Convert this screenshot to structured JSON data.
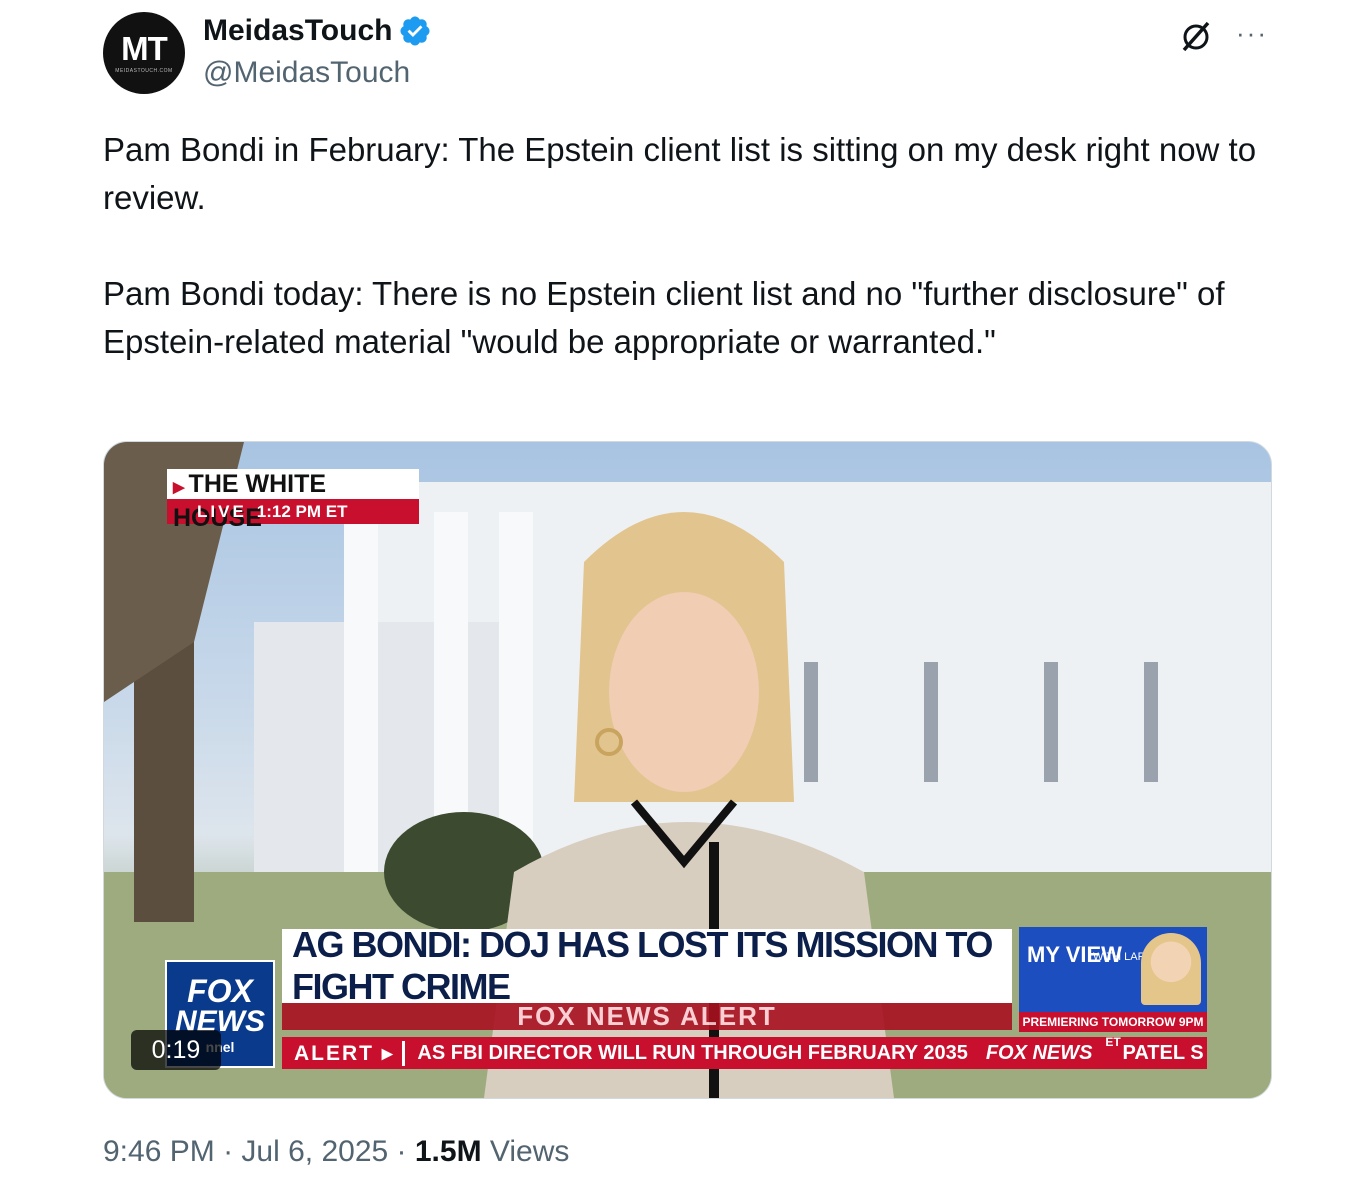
{
  "author": {
    "avatar_text": "MT",
    "avatar_subtext": "MEIDASTOUCH.COM",
    "display_name": "MeidasTouch",
    "handle": "@MeidasTouch",
    "verified_icon": "verified-badge-icon"
  },
  "actions": {
    "grok_icon": "grok-icon",
    "more_label": "···"
  },
  "tweet": {
    "paragraph_1": "Pam Bondi in February: The Epstein client list is sitting on my desk right now to review.",
    "paragraph_2": "Pam Bondi today: There is no Epstein client list and no \"further disclosure\" of Epstein-related material \"would be appropriate or warranted.\""
  },
  "video": {
    "location": "THE WHITE HOUSE",
    "live_label": "LIVE",
    "live_time": "1:12 PM ET",
    "headline": "AG BONDI: DOJ HAS LOST ITS MISSION TO FIGHT CRIME",
    "alert_strip": "FOX NEWS ALERT",
    "ticker_label": "ALERT",
    "ticker_text": "AS FBI DIRECTOR WILL RUN THROUGH FEBRUARY 2035",
    "ticker_brand": "FOX NEWS",
    "ticker_next": "PATEL S",
    "network_logo_line1": "FOX",
    "network_logo_line2": "NEWS",
    "network_logo_line3": "nnel",
    "promo_title": "MY VIEW",
    "promo_with": "WITH LARA TRUMP",
    "promo_footer": "PREMIERING TOMORROW 9PM ET",
    "duration": "0:19"
  },
  "meta": {
    "time": "9:46 PM",
    "date": "Jul 6, 2025",
    "views_count": "1.5M",
    "views_label": "Views"
  }
}
